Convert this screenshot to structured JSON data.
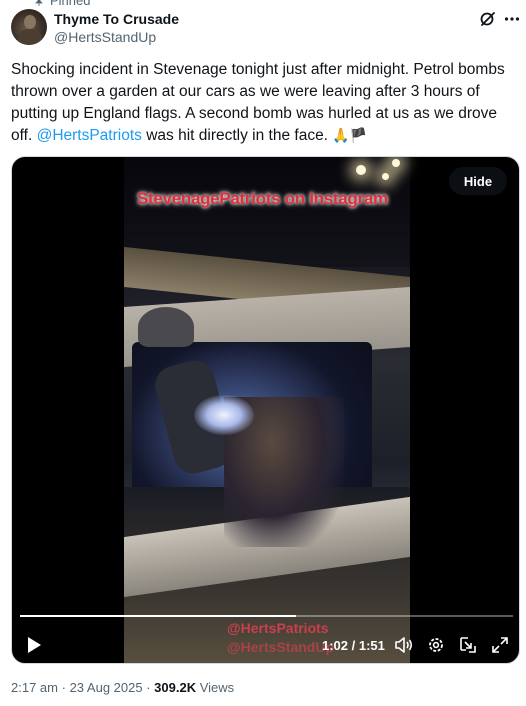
{
  "pinned_label": "Pinned",
  "author": {
    "name": "Thyme To Crusade",
    "handle": "@HertsStandUp"
  },
  "tweet": {
    "text_part1": "Shocking incident in Stevenage tonight just after midnight. Petrol bombs thrown over a garden at our cars as we were leaving after 3 hours of putting up England flags. A second bomb was hurled at us as we drove off. ",
    "mention": "@HertsPatriots",
    "text_part2": " was hit directly in the face. ",
    "emoji": "🙏🏴"
  },
  "media": {
    "overlay_top": "StevenagePatriots on Instagram",
    "overlay_bottom1": "@HertsPatriots",
    "overlay_bottom2": "@HertsStandUp",
    "hide_label": "Hide",
    "time_display": "1:02 / 1:51",
    "progress": 0.559
  },
  "meta": {
    "time": "2:17 am",
    "date": "23 Aug 2025",
    "views_count": "309.2K",
    "views_label": "Views"
  },
  "icons": {
    "pin": "pin-icon",
    "grok": "grok-icon",
    "more": "more-icon",
    "play": "play-icon",
    "volume": "volume-icon",
    "settings": "settings-icon",
    "pip": "picture-in-picture-icon",
    "fullscreen": "fullscreen-icon"
  }
}
